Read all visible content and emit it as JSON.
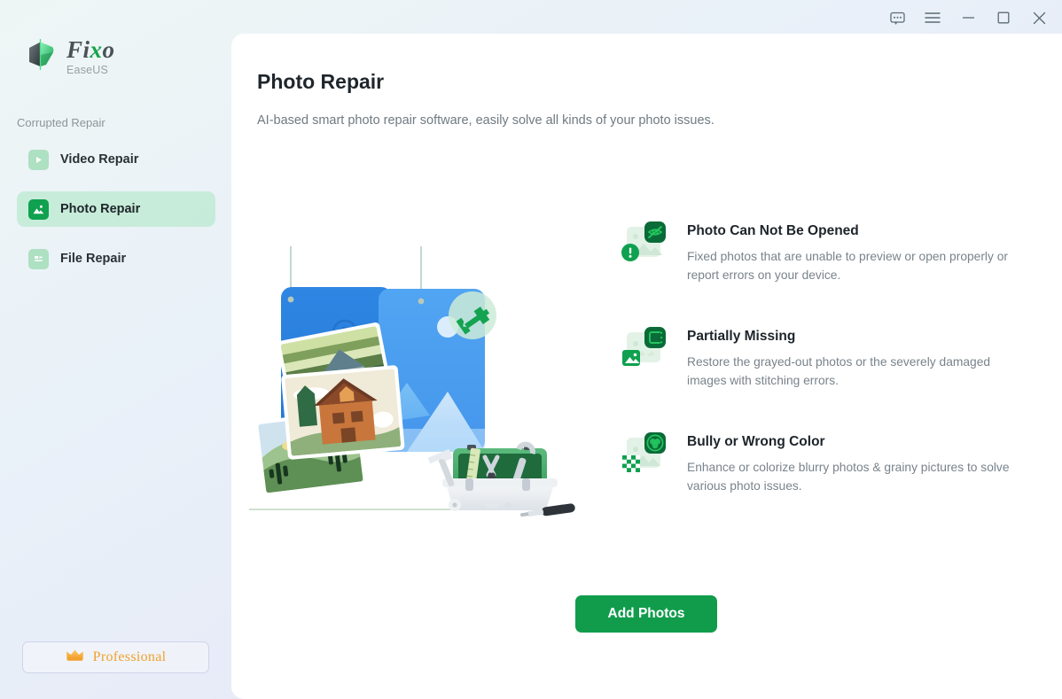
{
  "window": {
    "controls": [
      {
        "name": "feedback-icon",
        "label": "Feedback"
      },
      {
        "name": "menu-icon",
        "label": "Menu"
      },
      {
        "name": "minimize-icon",
        "label": "Minimize"
      },
      {
        "name": "maximize-icon",
        "label": "Maximize"
      },
      {
        "name": "close-icon",
        "label": "Close"
      }
    ]
  },
  "sidebar": {
    "brand": {
      "name": "Fixo",
      "name_prefix": "Fi",
      "name_accent": "x",
      "name_suffix": "o",
      "sub": "EaseUS"
    },
    "section_label": "Corrupted Repair",
    "items": [
      {
        "label": "Video Repair",
        "icon": "video-icon",
        "active": false
      },
      {
        "label": "Photo Repair",
        "icon": "photo-icon",
        "active": true
      },
      {
        "label": "File Repair",
        "icon": "file-icon",
        "active": false
      }
    ],
    "pro": {
      "label": "Professional",
      "icon": "crown-icon"
    }
  },
  "main": {
    "title": "Photo Repair",
    "subtitle": "AI-based smart photo repair software, easily solve all kinds of your photo issues.",
    "features": [
      {
        "title": "Photo Can Not Be Opened",
        "desc": "Fixed photos that are unable to preview or open properly or report errors on your device.",
        "badge_icon": "eye-slash-icon",
        "corner_icon": "alert-circle-icon"
      },
      {
        "title": "Partially Missing",
        "desc": "Restore the grayed-out photos or the severely damaged images with stitching errors.",
        "badge_icon": "dashed-frame-icon",
        "corner_icon": "image-icon"
      },
      {
        "title": "Bully or Wrong Color",
        "desc": "Enhance or colorize blurry photos & grainy pictures to solve various photo issues.",
        "badge_icon": "color-wheel-icon",
        "corner_icon": "checkerboard-icon"
      }
    ],
    "cta": {
      "label": "Add Photos"
    }
  },
  "colors": {
    "brand_green": "#119c4c",
    "badge_green": "#0b6b38",
    "accent_orange": "#f0a22e",
    "title_text": "#1f262b",
    "muted_text": "#79838b"
  }
}
